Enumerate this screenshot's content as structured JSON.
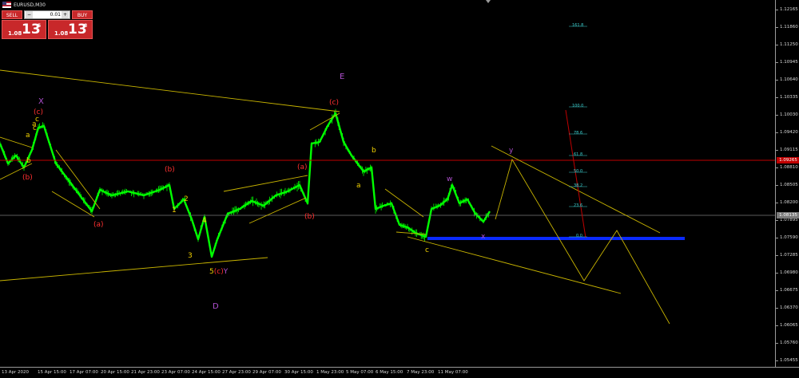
{
  "chart": {
    "symbol_title": "EURUSD,M30",
    "colors": {
      "candles": "#00ff00",
      "trendline": "#c8b400",
      "red_labels": "#ff3030",
      "purple_labels": "#b050d0",
      "yellow_labels": "#f0d000",
      "support_line": "#0a2aff",
      "resistance_line": "#c00000",
      "current_price_line": "#7a7a7a",
      "fib_text": "#3dd0d0"
    }
  },
  "trade_panel": {
    "sell_label": "SELL",
    "buy_label": "BUY",
    "lot_value": "0.01",
    "lot_minus": "−",
    "lot_plus": "+",
    "sell_price_prefix": "1.08",
    "sell_price_big": "13",
    "sell_price_sup": "5",
    "buy_price_prefix": "1.08",
    "buy_price_big": "13",
    "buy_price_sup": "8"
  },
  "price_axis": {
    "ticks": [
      "1.12165",
      "1.11860",
      "1.11250",
      "1.10945",
      "1.10640",
      "1.10335",
      "1.10030",
      "1.09420",
      "1.09115",
      "1.08810",
      "1.08505",
      "1.08200",
      "1.07895",
      "1.07590",
      "1.07285",
      "1.06980",
      "1.06675",
      "1.06370",
      "1.06065",
      "1.05760",
      "1.05455"
    ],
    "badge_red": "1.09265",
    "badge_current": "1.08135"
  },
  "time_axis": {
    "ticks": [
      "13 Apr 2020",
      "15 Apr 15:00",
      "17 Apr 07:00",
      "20 Apr 15:00",
      "21 Apr 23:00",
      "23 Apr 07:00",
      "24 Apr 15:00",
      "27 Apr 23:00",
      "29 Apr 07:00",
      "30 Apr 15:00",
      "1 May 23:00",
      "5 May 07:00",
      "6 May 15:00",
      "7 May 23:00",
      "11 May 07:00"
    ]
  },
  "fib_levels": [
    "161.8",
    "100.0",
    "78.6",
    "61.8",
    "50.0",
    "38.2",
    "23.6",
    "0.0"
  ],
  "wave_labels": {
    "X": "X",
    "E": "E",
    "D": "D",
    "Y": "5(c)Y",
    "c1": "(c)",
    "c2": "(c)",
    "b1": "(b)",
    "b2": "(b)",
    "b3": "(b)",
    "a1": "(a)",
    "a2": "(a)",
    "n1": "1",
    "n2": "2",
    "n3": "3",
    "n4": "4",
    "ya": "a",
    "yb": "b",
    "yc": "c",
    "yb2": "b",
    "ya2": "a",
    "yc2": "c",
    "yx": "x",
    "yy": "y",
    "yw": "w",
    "ya3": "a",
    "yc3": "c"
  }
}
